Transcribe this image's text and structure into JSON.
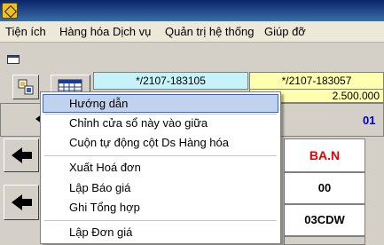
{
  "menubar": {
    "items": [
      {
        "label": "Tiện ích"
      },
      {
        "label": "Hàng hóa Dịch vụ"
      },
      {
        "label": "Quản trị hệ thống"
      },
      {
        "label": "Giúp đỡ"
      }
    ]
  },
  "grid": {
    "header1": "*/2107-183105",
    "header2": "*/2107-183057",
    "amount": "2.500.000",
    "number": "01",
    "code1": "BA.N",
    "code2": "00",
    "code3": "03CDW"
  },
  "context_menu": {
    "items": [
      {
        "label": "Hướng dẫn"
      },
      {
        "label": "Chỉnh cửa sổ này vào giữa"
      },
      {
        "label": "Cuộn tự động cột Ds Hàng hóa"
      },
      {
        "label": "Xuất Hoá đơn"
      },
      {
        "label": "Lập Báo giá"
      },
      {
        "label": "Ghi Tổng hợp"
      },
      {
        "label": "Lập Đơn giá"
      }
    ]
  },
  "colors": {
    "header1_bg": "#c6f2fa",
    "header2_bg": "#ffffb0",
    "code1_text": "#e00000",
    "number_text": "#0000c0",
    "menu_highlight": "#c1d2ee"
  }
}
